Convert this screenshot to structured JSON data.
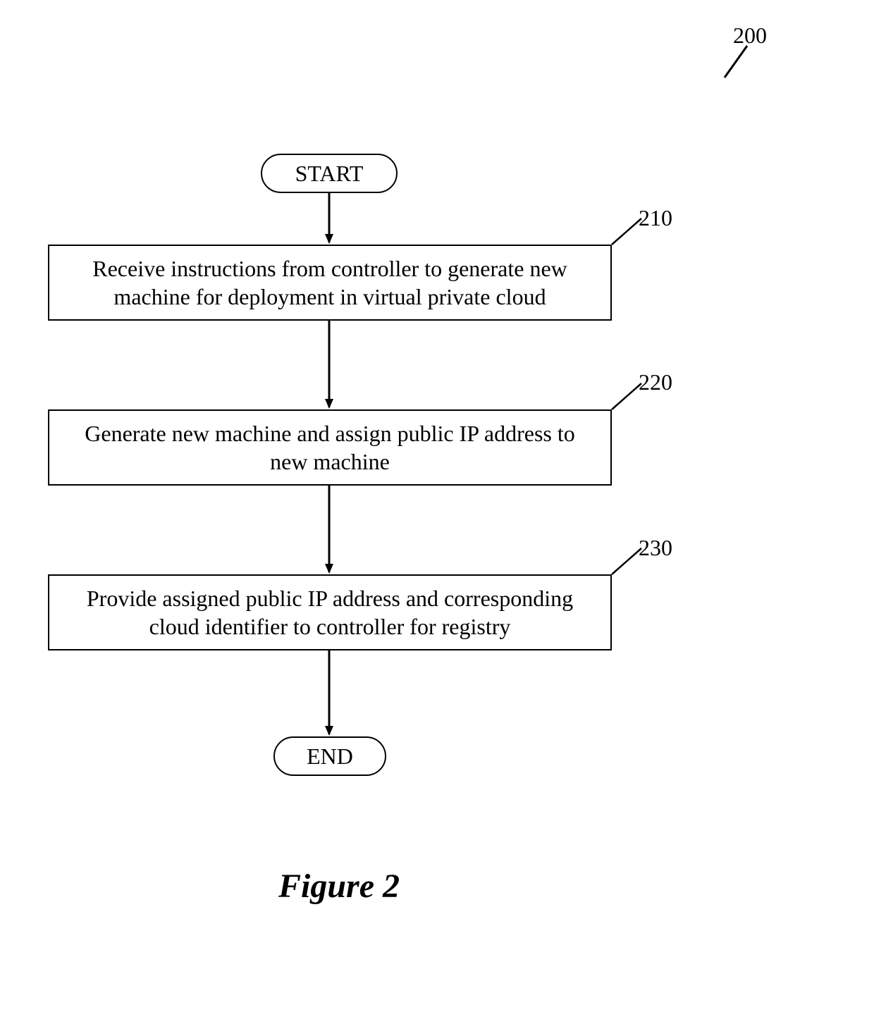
{
  "diagram": {
    "figure_number": "200",
    "figure_caption": "Figure 2",
    "start_label": "START",
    "end_label": "END",
    "steps": {
      "s210": {
        "ref": "210",
        "text": "Receive instructions from controller to generate new machine for deployment in virtual private cloud"
      },
      "s220": {
        "ref": "220",
        "text": "Generate new machine and assign public IP address to new machine"
      },
      "s230": {
        "ref": "230",
        "text": "Provide assigned public IP address and corresponding cloud identifier to controller for registry"
      }
    }
  }
}
